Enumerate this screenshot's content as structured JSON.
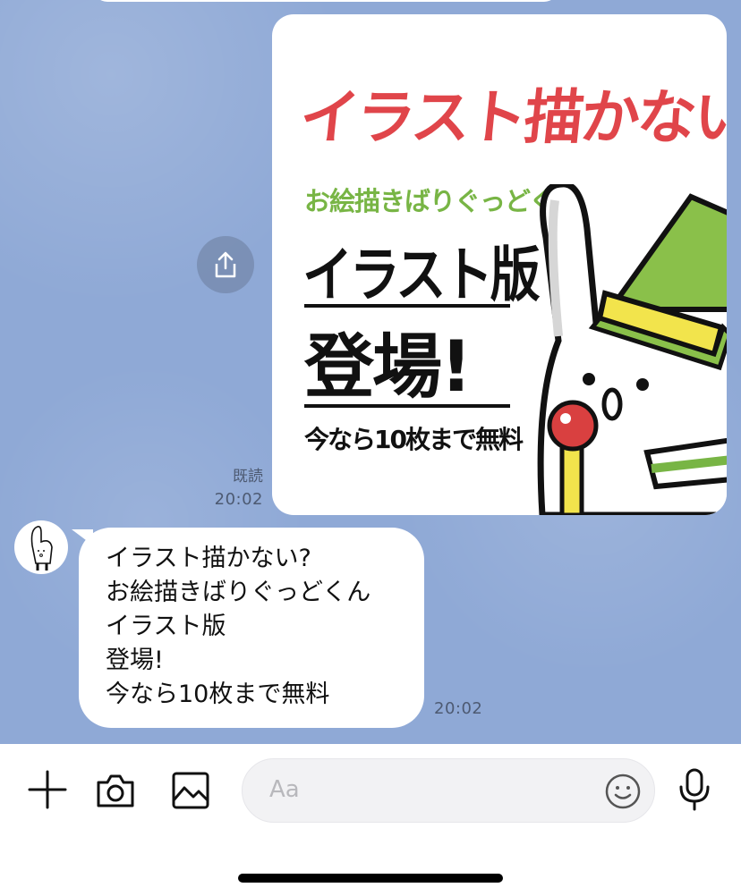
{
  "chat": {
    "read_receipt": "既読",
    "image_time": "20:02",
    "image": {
      "title": "イラスト描かない?",
      "subtitle": "お絵描きばりぐっどくん",
      "edition": "イラスト版",
      "debut": "登場!",
      "offer": "今なら10枚まで無料"
    },
    "message": {
      "text": "イラスト描かない?\nお絵描きばりぐっどくん\nイラスト版\n登場!\n今なら10枚まで無料",
      "time": "20:02"
    }
  },
  "input_bar": {
    "placeholder": "Aa"
  },
  "colors": {
    "chat_background": "#8fa9d6",
    "title_red": "#e0454a",
    "subtitle_green": "#78b545"
  }
}
